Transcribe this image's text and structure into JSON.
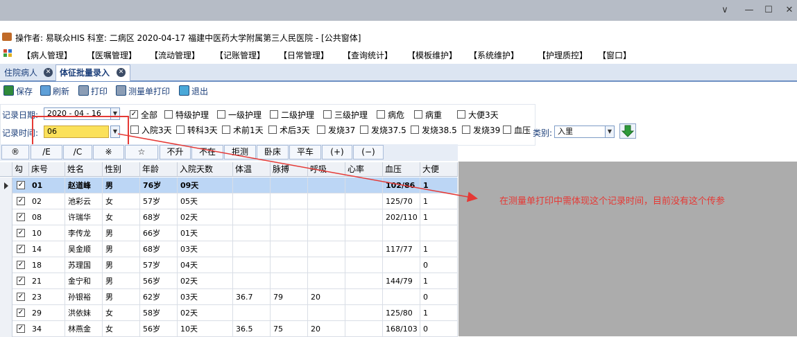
{
  "window": {
    "minimize_glyph": "∨",
    "restore_glyph": "—",
    "maximize_glyph": "☐",
    "close_glyph": "✕"
  },
  "info_bar": {
    "text": "操作者: 易联众HIS  科室: 二病区  2020-04-17  福建中医药大学附属第三人民医院 - [公共窗体]"
  },
  "menu": {
    "items": [
      "【病人管理】",
      "【医嘱管理】",
      "【流动管理】",
      "【记账管理】",
      "【日常管理】",
      "【查询统计】",
      "【模板维护】",
      "【系统维护】",
      "【护理质控】",
      "【窗口】"
    ]
  },
  "tabs": [
    {
      "label": "住院病人"
    },
    {
      "label": "体征批量录入"
    }
  ],
  "toolbar": {
    "save": "保存",
    "refresh": "刷新",
    "print": "打印",
    "measure_print": "测量单打印",
    "exit": "退出"
  },
  "filters": {
    "record_date_label": "记录日期:",
    "record_date_value": "2020 - 04 - 16",
    "record_time_label": "记录时间:",
    "record_time_value": "06",
    "checkboxes_row1": [
      {
        "label": "全部",
        "checked": true
      },
      {
        "label": "特级护理",
        "checked": false
      },
      {
        "label": "一级护理",
        "checked": false
      },
      {
        "label": "二级护理",
        "checked": false
      },
      {
        "label": "三级护理",
        "checked": false
      },
      {
        "label": "病危",
        "checked": false
      },
      {
        "label": "病重",
        "checked": false
      },
      {
        "label": "大便3天",
        "checked": false
      }
    ],
    "checkboxes_row2": [
      {
        "label": "入院3天",
        "checked": false
      },
      {
        "label": "转科3天",
        "checked": false
      },
      {
        "label": "术前1天",
        "checked": false
      },
      {
        "label": "术后3天",
        "checked": false
      },
      {
        "label": "发烧37",
        "checked": false
      },
      {
        "label": "发烧37.5",
        "checked": false
      },
      {
        "label": "发烧38.5",
        "checked": false
      },
      {
        "label": "发烧39",
        "checked": false
      },
      {
        "label": "血压",
        "checked": false
      }
    ],
    "category_label": "类别:",
    "category_value": "入里",
    "check_mark": "✓"
  },
  "symbol_buttons": [
    "®",
    "/E",
    "/C",
    "※",
    "☆",
    "不升",
    "不在",
    "拒测",
    "卧床",
    "平车",
    "(+)",
    "(−)"
  ],
  "grid": {
    "headers": [
      "勾",
      "床号",
      "姓名",
      "性别",
      "年龄",
      "入院天数",
      "体温",
      "脉搏",
      "呼吸",
      "心率",
      "血压",
      "大便"
    ],
    "rows": [
      {
        "bed": "01",
        "name": "赵道峰",
        "sex": "男",
        "age": "76岁",
        "days": "09天",
        "temp": "",
        "pulse": "",
        "resp": "",
        "hr": "",
        "bp": "102/86",
        "stool": "1"
      },
      {
        "bed": "02",
        "name": "池彩云",
        "sex": "女",
        "age": "57岁",
        "days": "05天",
        "temp": "",
        "pulse": "",
        "resp": "",
        "hr": "",
        "bp": "125/70",
        "stool": "1"
      },
      {
        "bed": "08",
        "name": "许瑞华",
        "sex": "女",
        "age": "68岁",
        "days": "02天",
        "temp": "",
        "pulse": "",
        "resp": "",
        "hr": "",
        "bp": "202/110",
        "stool": "1"
      },
      {
        "bed": "10",
        "name": "李传龙",
        "sex": "男",
        "age": "66岁",
        "days": "01天",
        "temp": "",
        "pulse": "",
        "resp": "",
        "hr": "",
        "bp": "",
        "stool": ""
      },
      {
        "bed": "14",
        "name": "吴金顺",
        "sex": "男",
        "age": "68岁",
        "days": "03天",
        "temp": "",
        "pulse": "",
        "resp": "",
        "hr": "",
        "bp": "117/77",
        "stool": "1"
      },
      {
        "bed": "18",
        "name": "苏理国",
        "sex": "男",
        "age": "57岁",
        "days": "04天",
        "temp": "",
        "pulse": "",
        "resp": "",
        "hr": "",
        "bp": "",
        "stool": "0"
      },
      {
        "bed": "21",
        "name": "金宁和",
        "sex": "男",
        "age": "56岁",
        "days": "02天",
        "temp": "",
        "pulse": "",
        "resp": "",
        "hr": "",
        "bp": "144/79",
        "stool": "1"
      },
      {
        "bed": "23",
        "name": "孙银裕",
        "sex": "男",
        "age": "62岁",
        "days": "03天",
        "temp": "36.7",
        "pulse": "79",
        "resp": "20",
        "hr": "",
        "bp": "",
        "stool": "0"
      },
      {
        "bed": "29",
        "name": "洪依妹",
        "sex": "女",
        "age": "58岁",
        "days": "02天",
        "temp": "",
        "pulse": "",
        "resp": "",
        "hr": "",
        "bp": "125/80",
        "stool": "1"
      },
      {
        "bed": "34",
        "name": "林燕金",
        "sex": "女",
        "age": "56岁",
        "days": "10天",
        "temp": "36.5",
        "pulse": "75",
        "resp": "20",
        "hr": "",
        "bp": "168/103",
        "stool": "0"
      }
    ]
  },
  "annotation": {
    "text": "在测量单打印中需体现这个记录时间，目前没有这个传参",
    "color": "#e53935"
  }
}
